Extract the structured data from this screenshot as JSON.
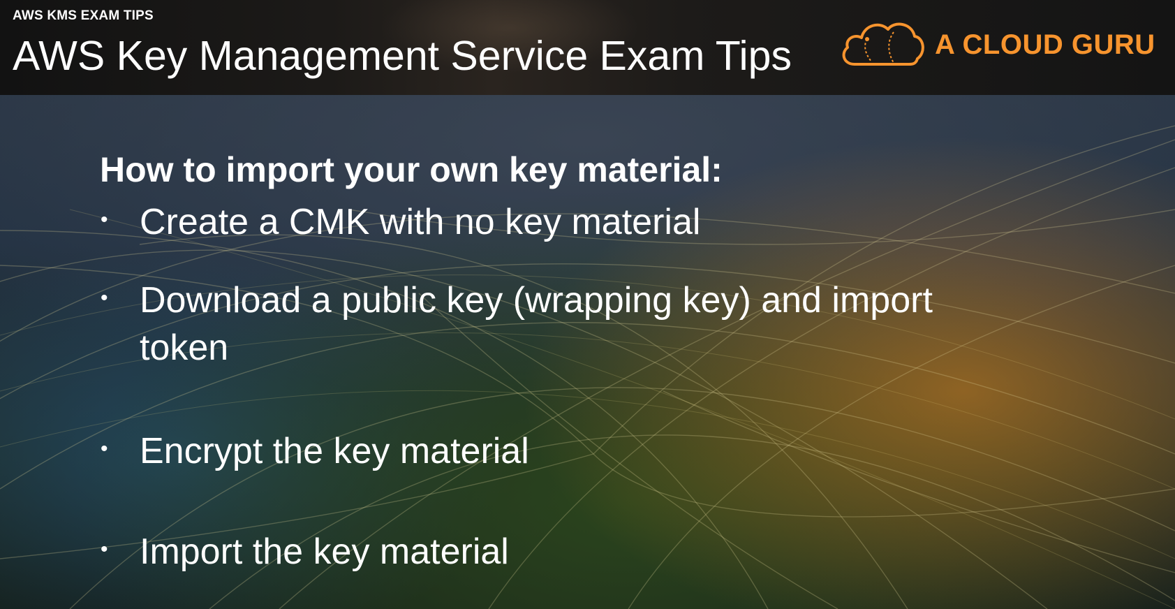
{
  "header": {
    "kicker": "AWS KMS EXAM TIPS",
    "title": "AWS Key Management Service Exam Tips"
  },
  "brand": {
    "name": "A CLOUD GURU",
    "logo_icon": "cloud-logo-icon",
    "accent_color": "#f7942e"
  },
  "slide": {
    "heading": "How to import your own key material:",
    "bullets": [
      "Create a CMK with no key material",
      "Download a public key (wrapping key) and import token",
      "Encrypt the key material",
      "Import the key material"
    ],
    "bullet_symbol": "•"
  }
}
